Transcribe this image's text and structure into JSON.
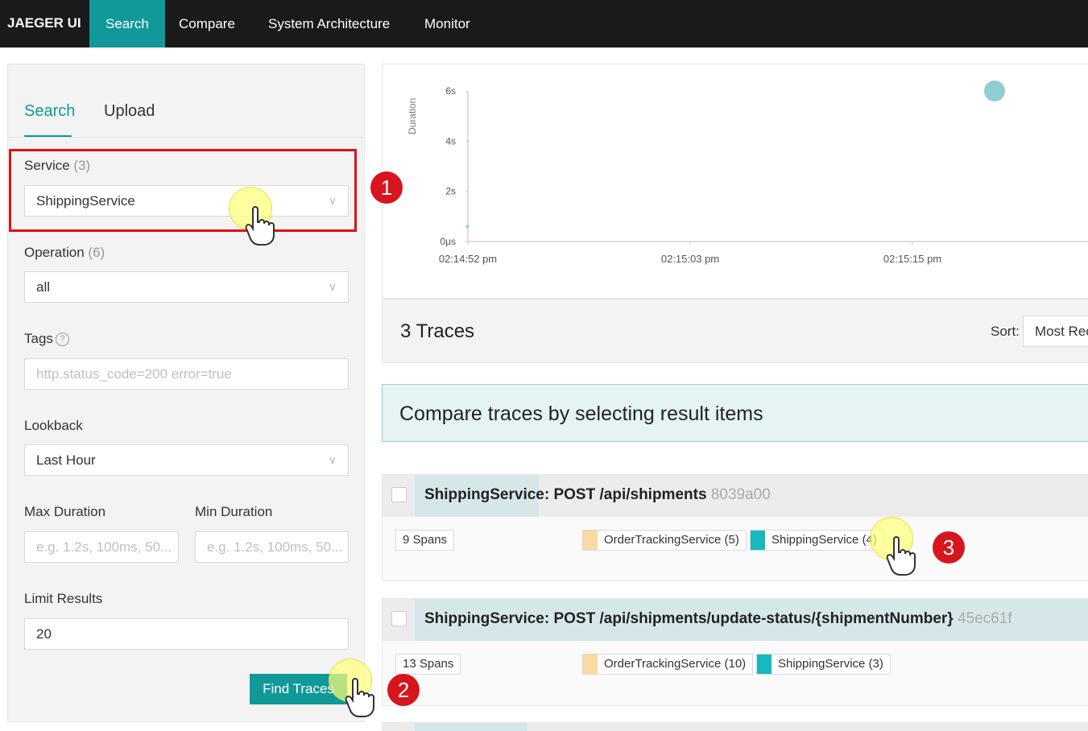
{
  "nav": {
    "brand": "JAEGER UI",
    "items": [
      {
        "label": "Search",
        "active": true
      },
      {
        "label": "Compare",
        "active": false
      },
      {
        "label": "System Architecture",
        "active": false
      },
      {
        "label": "Monitor",
        "active": false
      }
    ]
  },
  "search_panel": {
    "tabs": [
      "Search",
      "Upload"
    ],
    "service": {
      "label": "Service",
      "count": "(3)",
      "value": "ShippingService"
    },
    "operation": {
      "label": "Operation",
      "count": "(6)",
      "value": "all"
    },
    "tags": {
      "label": "Tags",
      "help": "?",
      "placeholder": "http.status_code=200 error=true"
    },
    "lookback": {
      "label": "Lookback",
      "value": "Last Hour"
    },
    "max_duration": {
      "label": "Max Duration",
      "placeholder": "e.g. 1.2s, 100ms, 50..."
    },
    "min_duration": {
      "label": "Min Duration",
      "placeholder": "e.g. 1.2s, 100ms, 50..."
    },
    "limit": {
      "label": "Limit Results",
      "value": "20"
    },
    "find_button": "Find Traces"
  },
  "callouts": [
    "1",
    "2",
    "3"
  ],
  "chart_data": {
    "type": "scatter",
    "ylabel": "Duration",
    "y_ticks": [
      "6s",
      "4s",
      "2s",
      "0μs"
    ],
    "x_ticks": [
      "02:14:52 pm",
      "02:15:03 pm",
      "02:15:15 pm"
    ],
    "points": [
      {
        "x": "02:14:52 pm",
        "y_seconds": 0.6,
        "size": "small"
      },
      {
        "x": "02:15:19 pm",
        "y_seconds": 6.0,
        "size": "large"
      }
    ],
    "ylim": [
      0,
      6.5
    ],
    "point_color": "#8fcfcf"
  },
  "results": {
    "count_label": "3 Traces",
    "sort_label": "Sort:",
    "sort_value": "Most Recent",
    "compare_hint": "Compare traces by selecting result items",
    "traces": [
      {
        "title": "ShippingService: POST /api/shipments",
        "trace_id": "8039a00",
        "spans": "9 Spans",
        "services": [
          {
            "name": "OrderTrackingService (5)",
            "color": "#fbd9a3"
          },
          {
            "name": "ShippingService (4)",
            "color": "#17b8be"
          }
        ]
      },
      {
        "title": "ShippingService: POST /api/shipments/update-status/{shipmentNumber}",
        "trace_id": "45ec61f",
        "spans": "13 Spans",
        "services": [
          {
            "name": "OrderTrackingService (10)",
            "color": "#fbd9a3"
          },
          {
            "name": "ShippingService (3)",
            "color": "#17b8be"
          }
        ]
      }
    ]
  },
  "colors": {
    "accent": "#119999",
    "nav_bg": "#1a1a1a",
    "callout": "#d6151d",
    "highlight": "#e01018"
  }
}
